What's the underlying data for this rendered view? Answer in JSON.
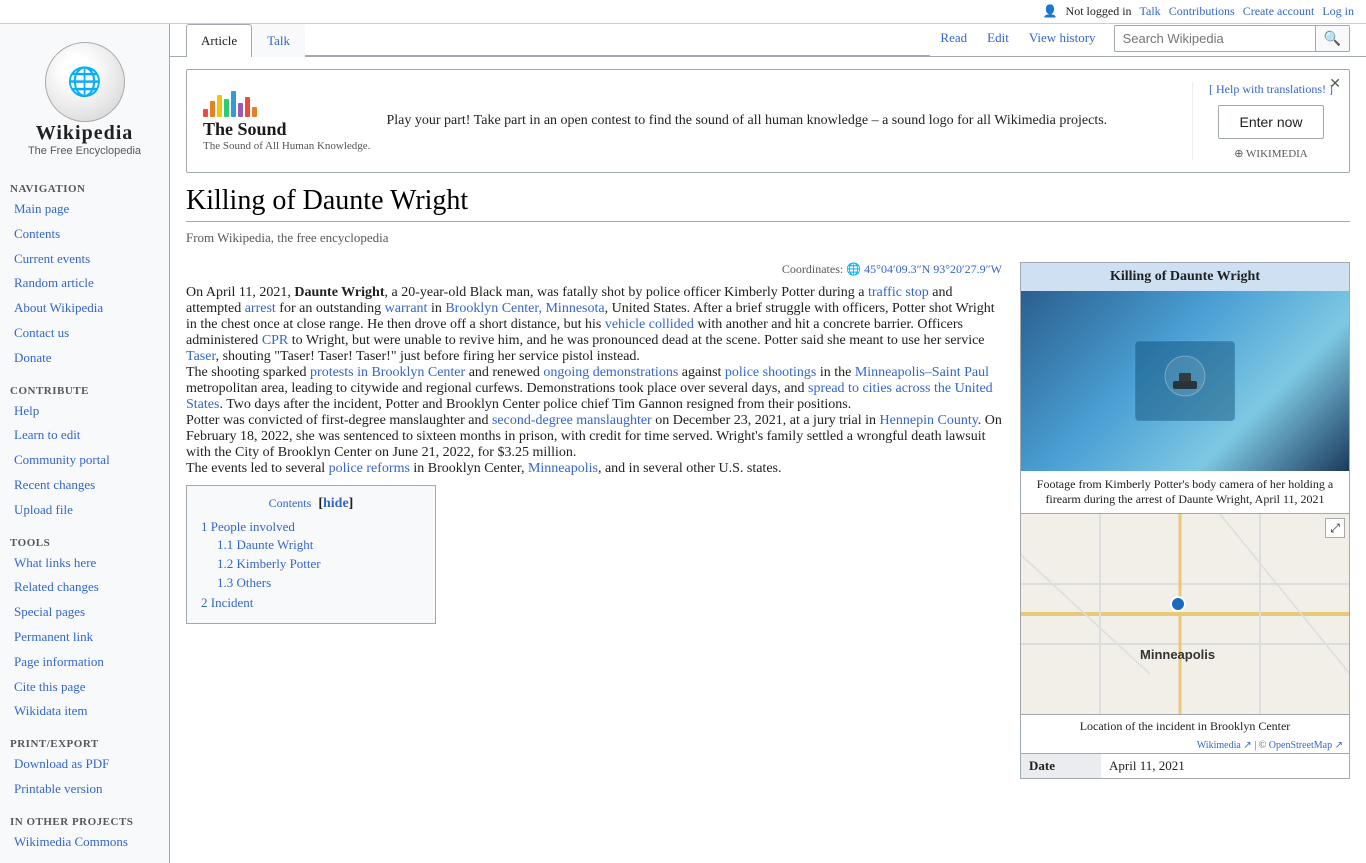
{
  "topbar": {
    "not_logged_in": "Not logged in",
    "talk": "Talk",
    "contributions": "Contributions",
    "create_account": "Create account",
    "log_in": "Log in"
  },
  "logo": {
    "title": "Wikipedia",
    "subtitle": "The Free Encyclopedia"
  },
  "sidebar": {
    "navigation_title": "Navigation",
    "items": [
      {
        "label": "Main page",
        "href": "#"
      },
      {
        "label": "Contents",
        "href": "#"
      },
      {
        "label": "Current events",
        "href": "#"
      },
      {
        "label": "Random article",
        "href": "#"
      },
      {
        "label": "About Wikipedia",
        "href": "#"
      },
      {
        "label": "Contact us",
        "href": "#"
      },
      {
        "label": "Donate",
        "href": "#"
      }
    ],
    "contribute_title": "Contribute",
    "contribute_items": [
      {
        "label": "Help",
        "href": "#"
      },
      {
        "label": "Learn to edit",
        "href": "#"
      },
      {
        "label": "Community portal",
        "href": "#"
      },
      {
        "label": "Recent changes",
        "href": "#"
      },
      {
        "label": "Upload file",
        "href": "#"
      }
    ],
    "tools_title": "Tools",
    "tools_items": [
      {
        "label": "What links here",
        "href": "#"
      },
      {
        "label": "Related changes",
        "href": "#"
      },
      {
        "label": "Special pages",
        "href": "#"
      },
      {
        "label": "Permanent link",
        "href": "#"
      },
      {
        "label": "Page information",
        "href": "#"
      },
      {
        "label": "Cite this page",
        "href": "#"
      },
      {
        "label": "Wikidata item",
        "href": "#"
      }
    ],
    "print_title": "Print/export",
    "print_items": [
      {
        "label": "Download as PDF",
        "href": "#"
      },
      {
        "label": "Printable version",
        "href": "#"
      }
    ],
    "other_title": "In other projects",
    "other_items": [
      {
        "label": "Wikimedia Commons",
        "href": "#"
      }
    ]
  },
  "tabs": {
    "article": "Article",
    "talk": "Talk",
    "read": "Read",
    "edit": "Edit",
    "view_history": "View history"
  },
  "search": {
    "placeholder": "Search Wikipedia"
  },
  "banner": {
    "help_link": "[ Help with translations! ]",
    "text": "Play your part! Take part in an open contest to find the sound of all human knowledge – a sound logo for all Wikimedia projects.",
    "enter_btn": "Enter now",
    "logo_text": "The Sound of All Human Knowledge."
  },
  "article": {
    "title": "Killing of Daunte Wright",
    "subtitle": "From Wikipedia, the free encyclopedia",
    "coordinates_label": "Coordinates:",
    "coordinates_value": "45°04′09.3″N 93°20′27.9″W",
    "intro_p1": "On April 11, 2021, Daunte Wright, a 20-year-old Black man, was fatally shot by police officer Kimberly Potter during a traffic stop and attempted arrest for an outstanding warrant in Brooklyn Center, Minnesota, United States. After a brief struggle with officers, Potter shot Wright in the chest once at close range. He then drove off a short distance, but his vehicle collided with another and hit a concrete barrier. Officers administered CPR to Wright, but were unable to revive him, and he was pronounced dead at the scene. Potter said she meant to use her service Taser, shouting \"Taser! Taser! Taser!\" just before firing her service pistol instead.",
    "intro_p2": "The shooting sparked protests in Brooklyn Center and renewed ongoing demonstrations against police shootings in the Minneapolis–Saint Paul metropolitan area, leading to citywide and regional curfews. Demonstrations took place over several days, and spread to cities across the United States. Two days after the incident, Potter and Brooklyn Center police chief Tim Gannon resigned from their positions.",
    "intro_p3": "Potter was convicted of first-degree manslaughter and second-degree manslaughter on December 23, 2021, at a jury trial in Hennepin County. On February 18, 2022, she was sentenced to sixteen months in prison, with credit for time served. Wright's family settled a wrongful death lawsuit with the City of Brooklyn Center on June 21, 2022, for $3.25 million.",
    "intro_p4": "The events led to several police reforms in Brooklyn Center, Minneapolis, and in several other U.S. states.",
    "infobox": {
      "title": "Killing of Daunte Wright",
      "img_caption": "Footage from Kimberly Potter's body camera of her holding a firearm during the arrest of Daunte Wright, April 11, 2021",
      "map_caption": "Location of the incident in Brooklyn Center",
      "map_label": "Minneapolis",
      "map_attribution": "Wikimedia ↗ | © OpenStreetMap ↗",
      "date_label": "Date",
      "date_value": "April 11, 2021"
    },
    "contents": {
      "title": "Contents",
      "hide": "hide",
      "items": [
        {
          "num": "1",
          "text": "People involved",
          "sub": [
            {
              "num": "1.1",
              "text": "Daunte Wright"
            },
            {
              "num": "1.2",
              "text": "Kimberly Potter"
            },
            {
              "num": "1.3",
              "text": "Others"
            }
          ]
        },
        {
          "num": "2",
          "text": "Incident"
        }
      ]
    }
  }
}
